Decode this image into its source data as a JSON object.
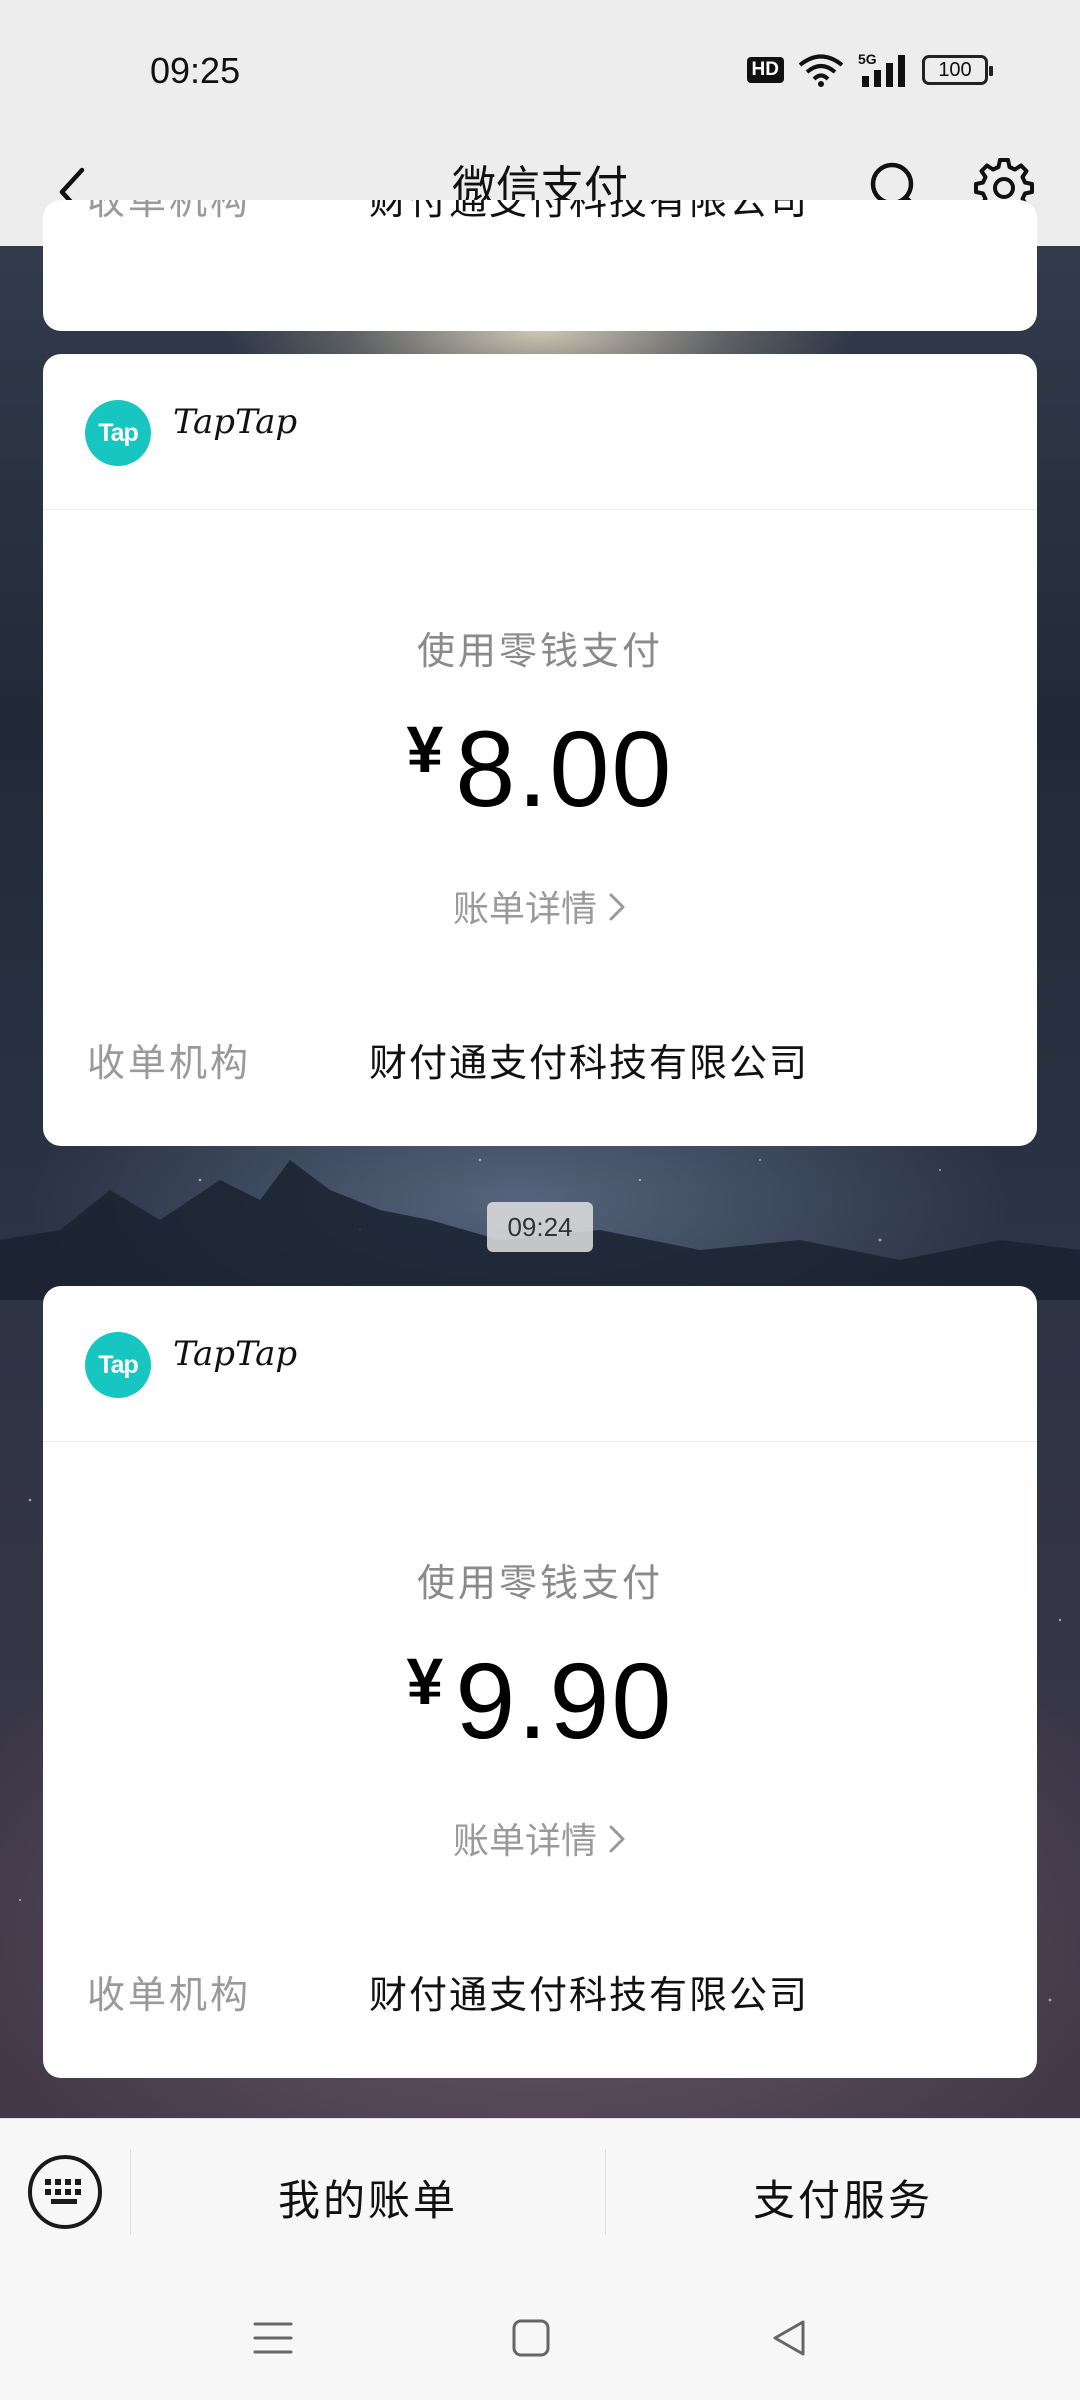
{
  "status_bar": {
    "time": "09:25",
    "hd": "HD",
    "network": "5G",
    "battery": "100"
  },
  "nav": {
    "title": "微信支付",
    "back_icon": "chevron-left-icon",
    "search_icon": "search-icon",
    "settings_icon": "gear-icon"
  },
  "partial_card": {
    "label": "收单机构",
    "value": "财付通支付科技有限公司"
  },
  "cards": [
    {
      "merchant": "TapTap",
      "logo_text": "Tap",
      "pay_method": "使用零钱支付",
      "currency": "¥",
      "amount": "8.00",
      "detail_label": "账单详情",
      "institution_label": "收单机构",
      "institution_value": "财付通支付科技有限公司"
    },
    {
      "merchant": "TapTap",
      "logo_text": "Tap",
      "pay_method": "使用零钱支付",
      "currency": "¥",
      "amount": "9.90",
      "detail_label": "账单详情",
      "institution_label": "收单机构",
      "institution_value": "财付通支付科技有限公司"
    }
  ],
  "timestamp": "09:24",
  "bottom_bar": {
    "keyboard_icon": "keyboard-icon",
    "tab_bills": "我的账单",
    "tab_services": "支付服务"
  },
  "colors": {
    "logo": "#17c6c1",
    "page_chrome": "#ededed"
  }
}
